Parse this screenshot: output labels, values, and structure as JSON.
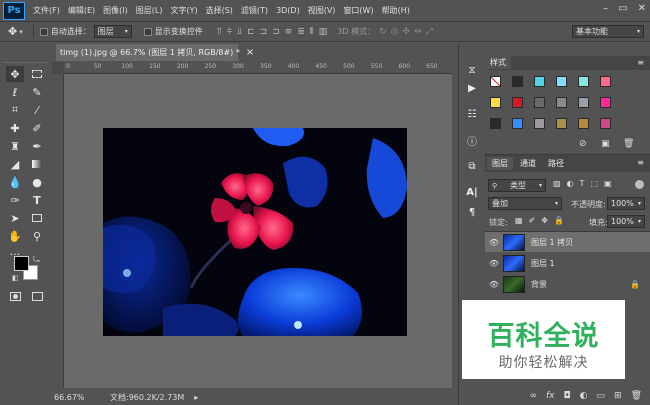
{
  "app": {
    "logo_text": "Ps"
  },
  "menu": [
    "文件(F)",
    "编辑(E)",
    "图像(I)",
    "图层(L)",
    "文字(Y)",
    "选择(S)",
    "滤镜(T)",
    "3D(D)",
    "视图(V)",
    "窗口(W)",
    "帮助(H)"
  ],
  "window_controls": {
    "minimize": "–",
    "restore": "▭",
    "close": "✕"
  },
  "options": {
    "auto_select_label": "自动选择：",
    "auto_select_value": "图层",
    "show_transform_label": "显示变换控件",
    "mode_3d_label": "3D 模式：",
    "workspace_value": "基本功能"
  },
  "document": {
    "tab_title": "timg (1).jpg @ 66.7% (图层 1 拷贝, RGB/8#) *",
    "tab_close": "×",
    "ruler_marks": [
      "0",
      "50",
      "100",
      "150",
      "200",
      "250",
      "300",
      "350",
      "400",
      "450",
      "500",
      "550",
      "600",
      "650"
    ],
    "zoom": "66.67%",
    "doc_size": "文档:960.2K/2.73M"
  },
  "styles_panel": {
    "title": "样式"
  },
  "layers_panel": {
    "tabs": [
      "图层",
      "通道",
      "路径"
    ],
    "filter_label": "类型",
    "blend_mode": "叠加",
    "opacity_label": "不透明度:",
    "opacity_value": "100%",
    "lock_label": "锁定:",
    "fill_label": "填充:",
    "fill_value": "100%",
    "layers": [
      {
        "name": "图层 1 拷贝",
        "selected": true
      },
      {
        "name": "图层 1",
        "selected": false
      },
      {
        "name": "背景",
        "selected": false,
        "locked": true
      }
    ],
    "footer_icons": [
      "link-icon",
      "fx-icon",
      "mask-icon",
      "adjustment-icon",
      "group-icon",
      "new-layer-icon",
      "delete-icon"
    ],
    "fx_text": "fx"
  },
  "watermark": {
    "title": "百科全说",
    "subtitle": "助你轻松解决"
  },
  "colors": {
    "panel": "#535353",
    "canvas_bg": "#6a6a6a",
    "accent_blue": "#31a8ff",
    "watermark_green": "#2fb25b",
    "selected_layer": "#6e6e6e"
  }
}
